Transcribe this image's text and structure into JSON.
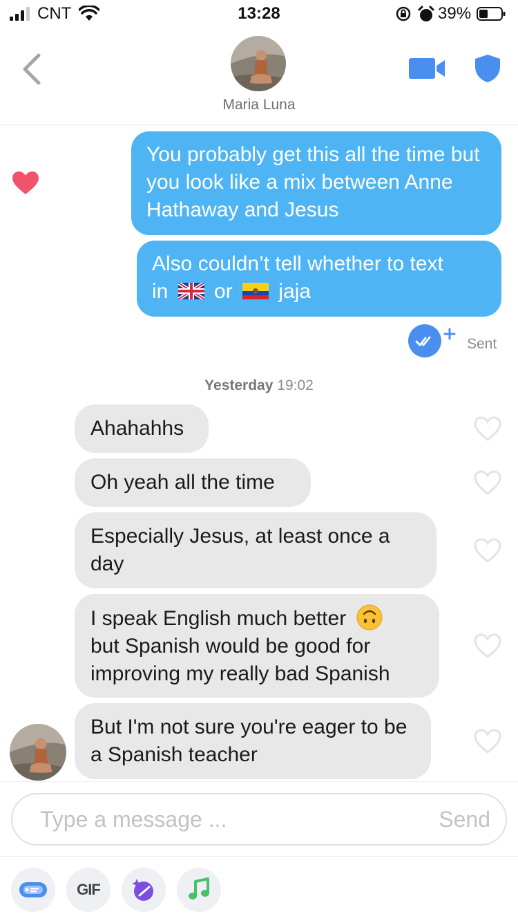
{
  "status_bar": {
    "carrier": "CNT",
    "time": "13:28",
    "battery": "39%"
  },
  "header": {
    "contact_name": "Maria Luna"
  },
  "messages_out": [
    {
      "text": "You probably get this all the time but you look like a mix between Anne Hathaway and Jesus"
    },
    {
      "text_a": "Also couldn’t tell whether to text",
      "text_b": "in",
      "text_c": "or",
      "text_d": "jaja",
      "flags": [
        "uk-flag",
        "ecuador-flag"
      ]
    }
  ],
  "sent_status": "Sent",
  "timestamp": {
    "day": "Yesterday",
    "time": "19:02"
  },
  "messages_in": [
    {
      "text": "Ahahahhs"
    },
    {
      "text": "Oh yeah all the time"
    },
    {
      "text": "Especially Jesus, at least once a day"
    },
    {
      "text": "I speak English much better",
      "text2": "but Spanish would be good for improving my really bad Spanish",
      "emoji": "upside-down-face"
    },
    {
      "text": "But I'm not sure you're eager to be a Spanish teacher"
    }
  ],
  "composer": {
    "placeholder": "Type a message ...",
    "send_label": "Send"
  },
  "toolbar": {
    "gif_label": "GIF",
    "icons": [
      "sticker-icon",
      "gif-icon",
      "sparkle-icon",
      "music-icon"
    ]
  },
  "colors": {
    "outgoing": "#4fb4f4",
    "incoming": "#e8e8e8",
    "accent": "#4a8ff0",
    "heart": "#f0536b"
  }
}
